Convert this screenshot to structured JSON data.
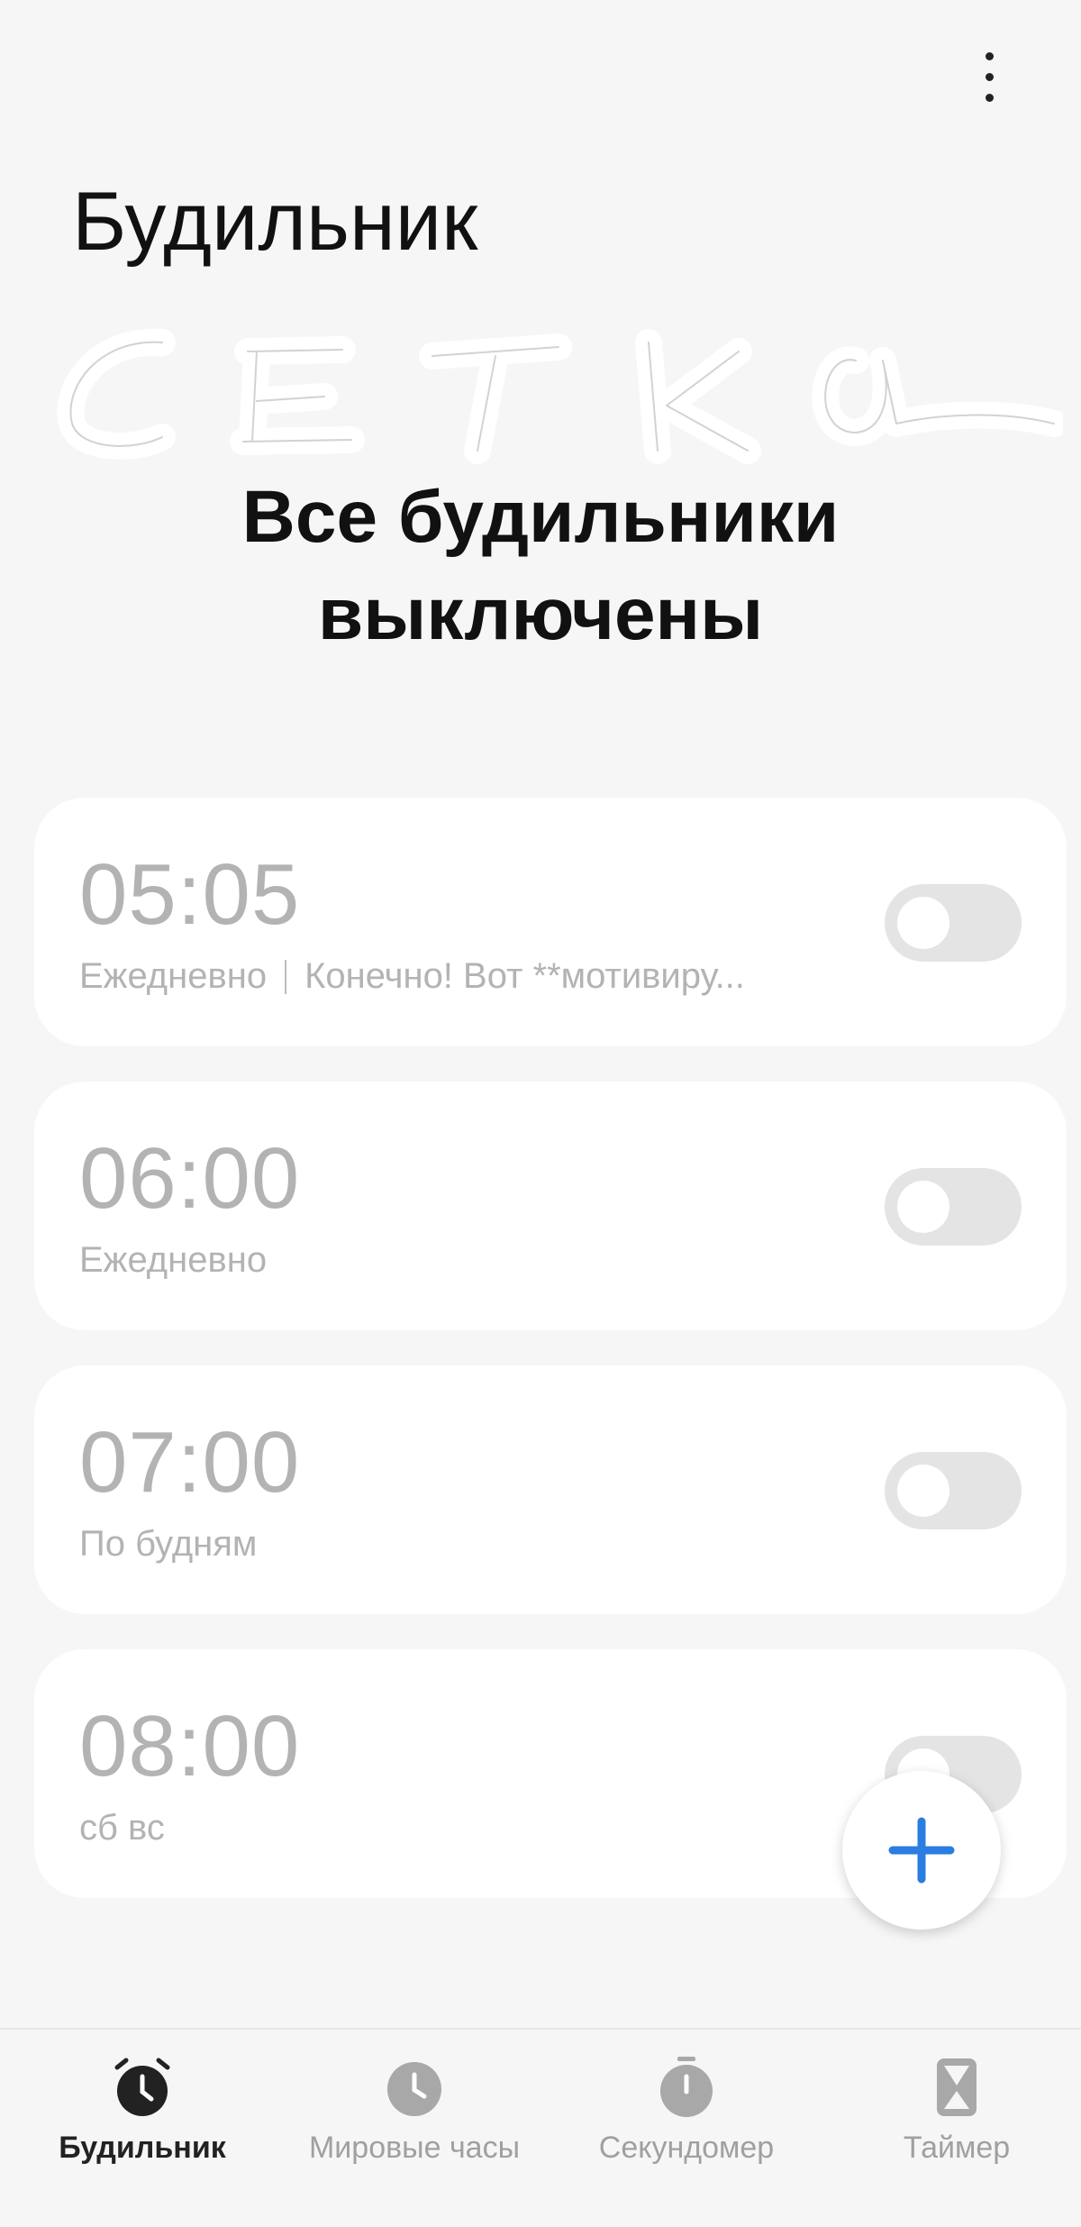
{
  "header": {
    "title": "Будильник",
    "more_icon": "more-vertical-icon"
  },
  "watermark": {
    "text": "СЕТКА"
  },
  "status": {
    "line1": "Все будильники",
    "line2": "выключены"
  },
  "alarms": [
    {
      "time": "05:05",
      "repeat": "Ежедневно",
      "label": "Конечно! Вот **мотивиру...",
      "enabled": false
    },
    {
      "time": "06:00",
      "repeat": "Ежедневно",
      "label": "",
      "enabled": false
    },
    {
      "time": "07:00",
      "repeat": "По будням",
      "label": "",
      "enabled": false
    },
    {
      "time": "08:00",
      "repeat": "сб вс",
      "label": "",
      "enabled": false
    }
  ],
  "fab": {
    "icon": "plus-icon",
    "color": "#2a7de1"
  },
  "bottom_nav": {
    "active": 0,
    "items": [
      {
        "label": "Будильник",
        "icon": "alarm-clock-icon"
      },
      {
        "label": "Мировые часы",
        "icon": "world-clock-icon"
      },
      {
        "label": "Секундомер",
        "icon": "stopwatch-icon"
      },
      {
        "label": "Таймер",
        "icon": "hourglass-icon"
      }
    ]
  },
  "colors": {
    "background": "#f6f6f6",
    "card": "#ffffff",
    "muted_text": "#b3b3b3",
    "toggle_off": "#e4e4e4",
    "accent": "#2a7de1",
    "active_nav": "#222222",
    "inactive_nav": "#a0a0a0"
  }
}
